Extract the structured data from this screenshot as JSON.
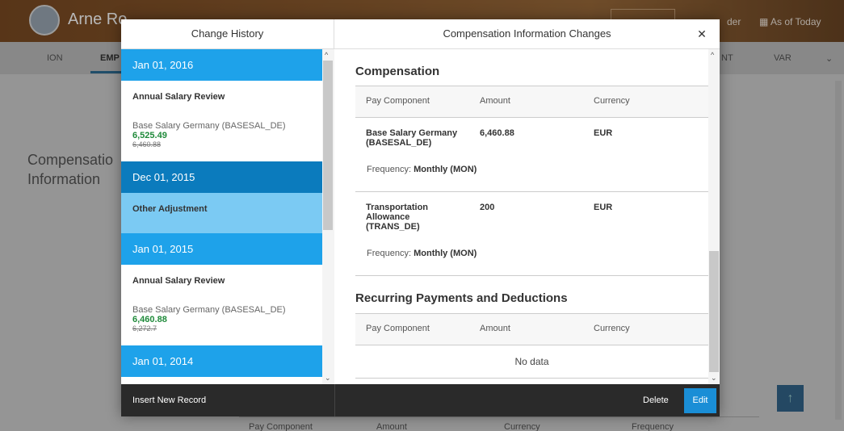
{
  "background": {
    "employee_name": "Arne Ro",
    "header_right": {
      "reader": "der",
      "as_of": "As of Today"
    },
    "nav": [
      "ION",
      "EMP",
      "NT",
      "VAR"
    ],
    "page_title_line1": "Compensatio",
    "page_title_line2": "Information",
    "table_headers": [
      "Pay Component",
      "Amount",
      "Currency",
      "Frequency"
    ]
  },
  "dialog": {
    "left_title": "Change History",
    "right_title": "Compensation Information Changes",
    "history": [
      {
        "date": "Jan 01, 2016",
        "event": "Annual Salary Review",
        "pay_component": "Base Salary Germany (BASESAL_DE)",
        "new_value": "6,525.49",
        "old_value": "6,460.88"
      },
      {
        "date": "Dec 01, 2015",
        "event": "Other Adjustment"
      },
      {
        "date": "Jan 01, 2015",
        "event": "Annual Salary Review",
        "pay_component": "Base Salary Germany (BASESAL_DE)",
        "new_value": "6,460.88",
        "old_value": "6,272.7"
      },
      {
        "date": "Jan 01, 2014"
      }
    ],
    "compensation": {
      "title": "Compensation",
      "headers": [
        "Pay Component",
        "Amount",
        "Currency"
      ],
      "frequency_label": "Frequency:",
      "rows": [
        {
          "component_l1": "Base Salary Germany",
          "component_l2": "(BASESAL_DE)",
          "amount": "6,460.88",
          "currency": "EUR",
          "frequency": "Monthly (MON)"
        },
        {
          "component_l1": "Transportation",
          "component_l2": "Allowance",
          "component_l3": "(TRANS_DE)",
          "amount": "200",
          "currency": "EUR",
          "frequency": "Monthly (MON)"
        }
      ]
    },
    "recurring": {
      "title": "Recurring Payments and Deductions",
      "headers": [
        "Pay Component",
        "Amount",
        "Currency"
      ],
      "empty_text": "No data"
    },
    "footer": {
      "insert": "Insert New Record",
      "delete": "Delete",
      "edit": "Edit"
    },
    "close_icon": "close-icon",
    "colors": {
      "date_row": "#1ea2ea",
      "selected_date": "#0b7bbd",
      "selected_item": "#7bcaf3",
      "new_value": "#1f8a3a",
      "edit_button": "#1a8ed6"
    }
  }
}
